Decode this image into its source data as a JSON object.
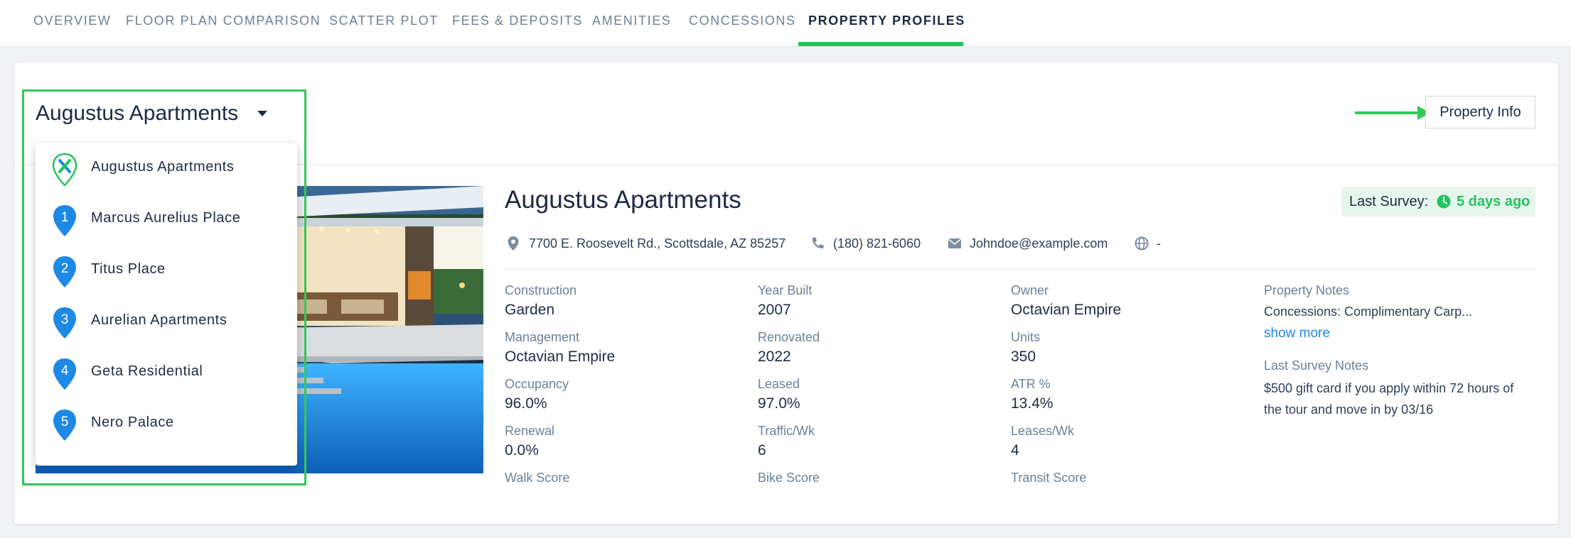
{
  "tabs": [
    {
      "label": "OVERVIEW"
    },
    {
      "label": "FLOOR PLAN COMPARISON"
    },
    {
      "label": "SCATTER PLOT"
    },
    {
      "label": "FEES & DEPOSITS"
    },
    {
      "label": "AMENITIES"
    },
    {
      "label": "CONCESSIONS"
    },
    {
      "label": "PROPERTY PROFILES"
    }
  ],
  "active_tab": "PROPERTY PROFILES",
  "selector": {
    "selected": "Augustus Apartments"
  },
  "dropdown": {
    "items": [
      {
        "label": "Augustus Apartments",
        "marker": "X",
        "icon": "subject-property-icon"
      },
      {
        "label": "Marcus Aurelius Place",
        "marker": "1",
        "icon": "map-pin-icon"
      },
      {
        "label": "Titus Place",
        "marker": "2",
        "icon": "map-pin-icon"
      },
      {
        "label": "Aurelian Apartments",
        "marker": "3",
        "icon": "map-pin-icon"
      },
      {
        "label": "Geta Residential",
        "marker": "4",
        "icon": "map-pin-icon"
      },
      {
        "label": "Nero Palace",
        "marker": "5",
        "icon": "map-pin-icon"
      }
    ]
  },
  "property_info_button": "Property Info",
  "property": {
    "name": "Augustus Apartments",
    "last_survey_label": "Last Survey:",
    "last_survey_value": "5 days ago",
    "address": "7700 E. Roosevelt Rd., Scottsdale, AZ 85257",
    "phone": "(180) 821-6060",
    "email": "Johndoe@example.com",
    "website": "-",
    "fields": {
      "construction": {
        "label": "Construction",
        "value": "Garden"
      },
      "year_built": {
        "label": "Year Built",
        "value": "2007"
      },
      "owner": {
        "label": "Owner",
        "value": "Octavian Empire"
      },
      "management": {
        "label": "Management",
        "value": "Octavian Empire"
      },
      "renovated": {
        "label": "Renovated",
        "value": "2022"
      },
      "units": {
        "label": "Units",
        "value": "350"
      },
      "occupancy": {
        "label": "Occupancy",
        "value": "96.0%"
      },
      "leased": {
        "label": "Leased",
        "value": "97.0%"
      },
      "atr": {
        "label": "ATR %",
        "value": "13.4%"
      },
      "renewal": {
        "label": "Renewal",
        "value": "0.0%"
      },
      "traffic": {
        "label": "Traffic/Wk",
        "value": "6"
      },
      "leases": {
        "label": "Leases/Wk",
        "value": "4"
      },
      "walk_score": {
        "label": "Walk Score",
        "value": ""
      },
      "bike_score": {
        "label": "Bike Score",
        "value": ""
      },
      "transit_score": {
        "label": "Transit Score",
        "value": ""
      }
    },
    "notes": {
      "title": "Property Notes",
      "text": "Concessions: Complimentary Carp...",
      "show_more": "show more",
      "last_survey_title": "Last Survey Notes",
      "last_survey_text": "$500 gift card if you apply within 72 hours of the tour and move in by 03/16"
    }
  },
  "colors": {
    "accent_green": "#22c55e",
    "highlight_green": "#34c759",
    "pin_blue": "#1e88e5",
    "link_blue": "#1e88e5",
    "text_dark": "#1e2a44",
    "label_gray": "#6d7f97"
  }
}
